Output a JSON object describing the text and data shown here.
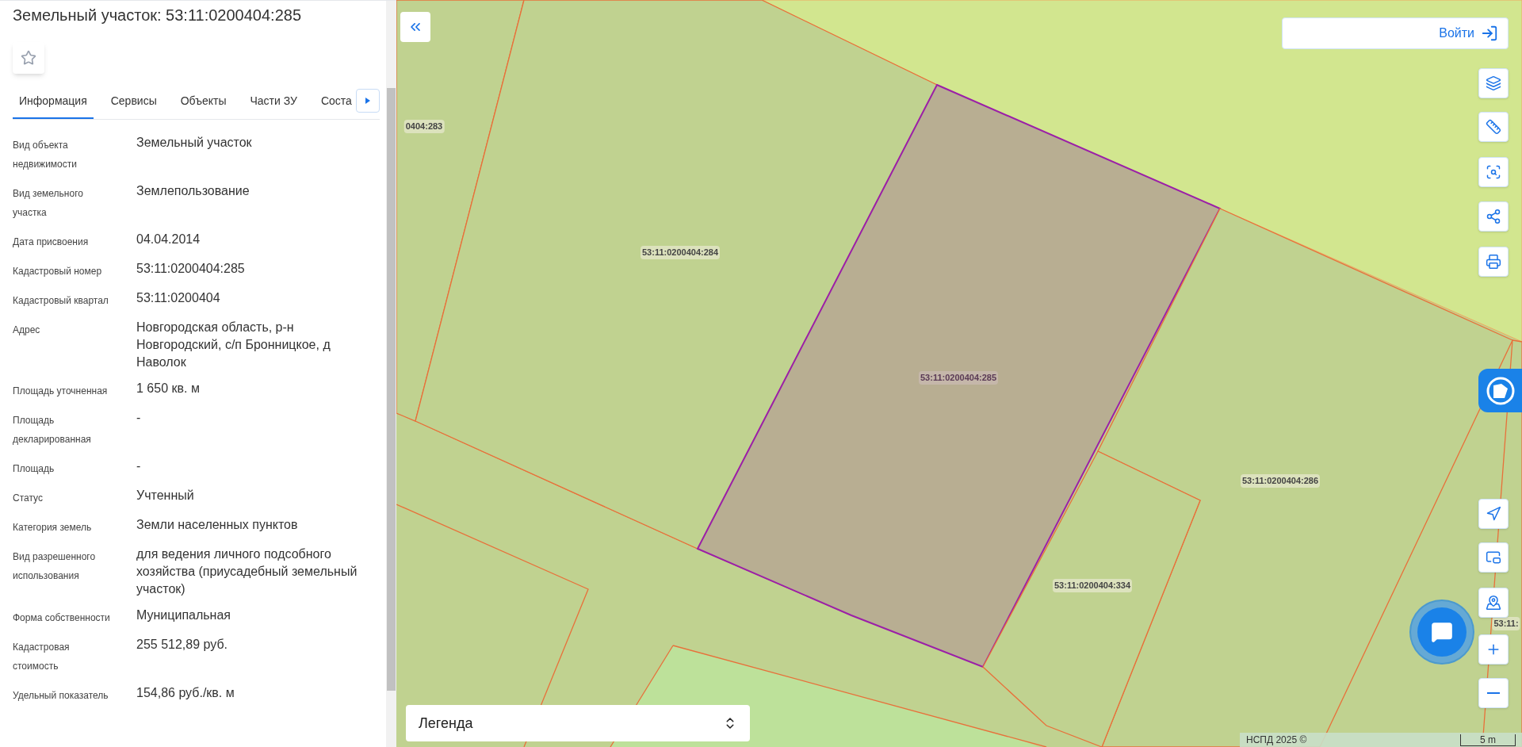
{
  "panel": {
    "title": "Земельный участок: 53:11:0200404:285",
    "favorite": {
      "on": false
    },
    "tabs": [
      {
        "label": "Информация",
        "selected": true
      },
      {
        "label": "Сервисы",
        "selected": false
      },
      {
        "label": "Объекты",
        "selected": false
      },
      {
        "label": "Части ЗУ",
        "selected": false
      },
      {
        "label": "Соста",
        "selected": false
      }
    ],
    "fields": [
      {
        "label": "Вид объекта недвижимости",
        "value": "Земельный участок"
      },
      {
        "label": "Вид земельного участка",
        "value": "Землепользование"
      },
      {
        "label": "Дата присвоения",
        "value": "04.04.2014"
      },
      {
        "label": "Кадастровый номер",
        "value": "53:11:0200404:285"
      },
      {
        "label": "Кадастровый квартал",
        "value": "53:11:0200404"
      },
      {
        "label": "Адрес",
        "value": "Новгородская область, р-н Новгородский, с/п Бронницкое, д Наволок"
      },
      {
        "label": "Площадь уточненная",
        "value": "1 650 кв. м"
      },
      {
        "label": "Площадь декларированная",
        "value": "-"
      },
      {
        "label": "Площадь",
        "value": "-"
      },
      {
        "label": "Статус",
        "value": "Учтенный"
      },
      {
        "label": "Категория земель",
        "value": "Земли населенных пунктов"
      },
      {
        "label": "Вид разрешенного использования",
        "value": "для ведения личного подсобного хозяйства (приусадебный земельный участок)"
      },
      {
        "label": "Форма собственности",
        "value": "Муниципальная"
      },
      {
        "label": "Кадастровая стоимость",
        "value": "255 512,89 руб."
      },
      {
        "label": "Удельный показатель",
        "value": "154,86 руб./кв. м"
      }
    ]
  },
  "map": {
    "login": "Войти",
    "parcels": [
      {
        "label": "0404:283",
        "selected": false
      },
      {
        "label": "53:11:0200404:284",
        "selected": false
      },
      {
        "label": "53:11:0200404:285",
        "selected": true
      },
      {
        "label": "53:11:0200404:286",
        "selected": false
      },
      {
        "label": "53:11:0200404:334",
        "selected": false
      },
      {
        "label": "53:11:",
        "selected": false
      }
    ],
    "legend": "Легенда",
    "attribution": "НСПД 2025 ©",
    "scale": "5 m"
  }
}
